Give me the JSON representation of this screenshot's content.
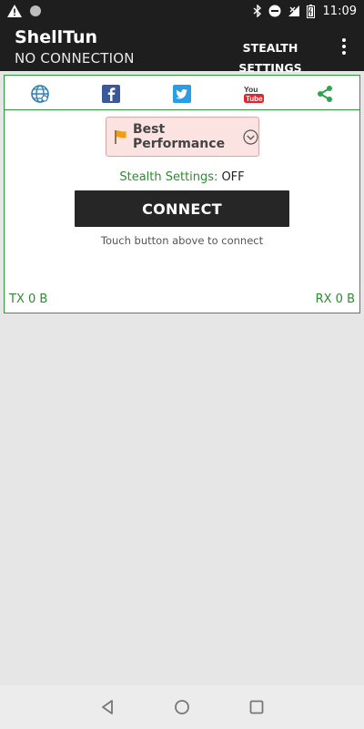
{
  "status_bar": {
    "time": "11:09",
    "left_icons": [
      "warning-icon",
      "circle-notification-icon"
    ],
    "right_icons": [
      "bluetooth-icon",
      "do-not-disturb-icon",
      "signal-icon",
      "battery-icon"
    ]
  },
  "app_bar": {
    "title": "ShellTun",
    "subtitle": "NO CONNECTION",
    "action_label": "STEALTH SETTINGS",
    "overflow_icon": "more-vert-icon"
  },
  "social_links": [
    {
      "icon": "globe-icon",
      "color": "#2f7fb5"
    },
    {
      "icon": "facebook-icon",
      "color": "#3b5998"
    },
    {
      "icon": "twitter-icon",
      "color": "#2a9de4"
    },
    {
      "icon": "youtube-icon",
      "color": "#e0262a"
    },
    {
      "icon": "share-icon",
      "color": "#2ea44f"
    }
  ],
  "performance": {
    "selected": "Best Performance",
    "flag_icon": "orange-flag-icon",
    "chevron_icon": "chevron-down-circle-icon"
  },
  "stealth": {
    "label": "Stealth Settings:",
    "value": "OFF"
  },
  "connect": {
    "button_label": "CONNECT",
    "hint": "Touch button above to connect"
  },
  "traffic": {
    "tx": "TX 0 B",
    "rx": "RX 0 B"
  },
  "colors": {
    "accent_green": "#2e9a3a",
    "bar_dark": "#1e1e1e",
    "button_dark": "#262626",
    "select_bg": "#fbe3e2"
  },
  "nav_bar": {
    "icons": [
      "back-icon",
      "home-icon",
      "recents-icon"
    ]
  }
}
